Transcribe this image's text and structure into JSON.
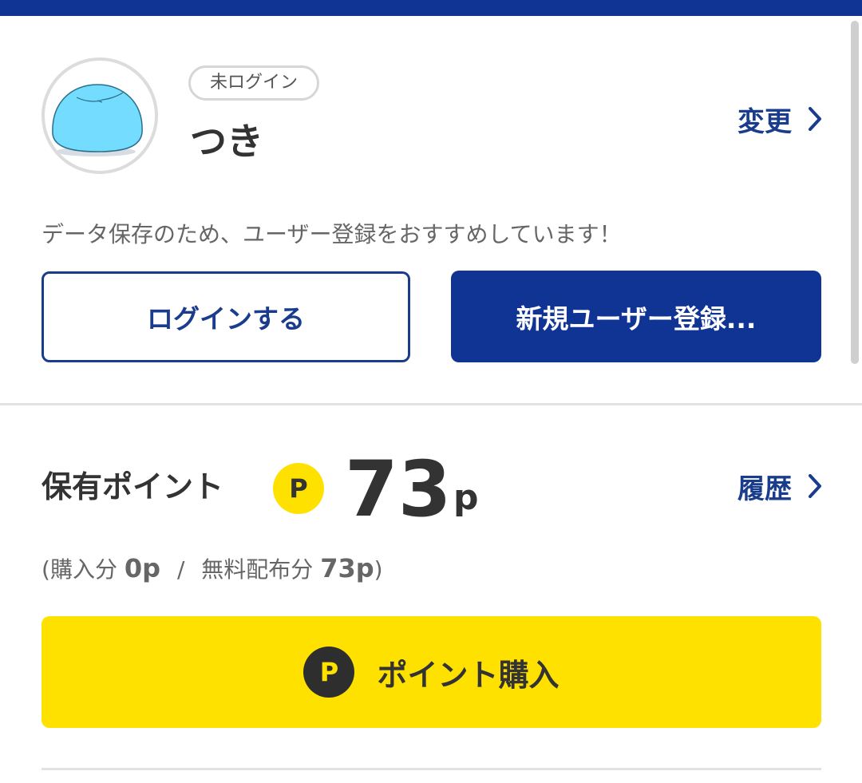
{
  "profile": {
    "status_badge": "未ログイン",
    "user_name": "つき",
    "change_label": "変更",
    "avatar_icon": "slime-avatar-icon"
  },
  "notice_text": "データ保存のため、ユーザー登録をおすすめしています！",
  "auth": {
    "login_label": "ログインする",
    "register_label": "新規ユーザー登録..."
  },
  "points": {
    "label": "保有ポイント",
    "coin_symbol": "P",
    "value": "73",
    "unit": "p",
    "history_label": "履歴",
    "breakdown": {
      "open_paren": "(",
      "purchased_label": "購入分",
      "purchased_value": "0p",
      "separator": "/",
      "free_label": "無料配布分",
      "free_value": "73p",
      "close_paren": ")"
    }
  },
  "purchase": {
    "coin_symbol": "P",
    "label": "ポイント購入"
  },
  "colors": {
    "brand_navy": "#0f3494",
    "link_navy": "#1a3c8c",
    "point_yellow": "#ffe100"
  }
}
